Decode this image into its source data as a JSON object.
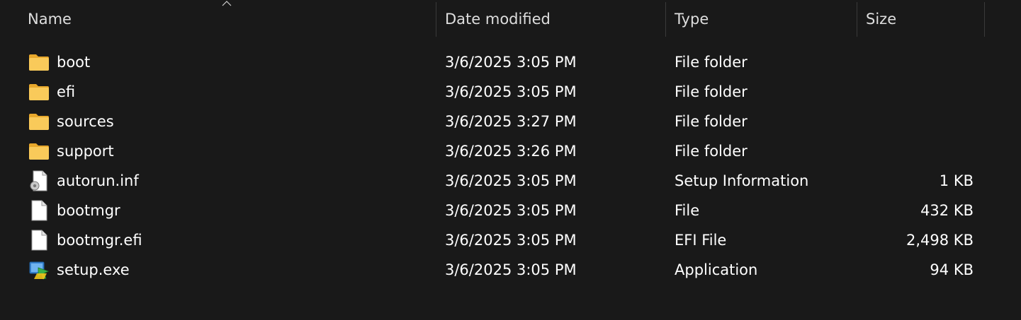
{
  "columns": {
    "name": "Name",
    "date": "Date modified",
    "type": "Type",
    "size": "Size"
  },
  "files": [
    {
      "name": "boot",
      "date": "3/6/2025 3:05 PM",
      "type": "File folder",
      "size": "",
      "icon": "folder-icon"
    },
    {
      "name": "efi",
      "date": "3/6/2025 3:05 PM",
      "type": "File folder",
      "size": "",
      "icon": "folder-icon"
    },
    {
      "name": "sources",
      "date": "3/6/2025 3:27 PM",
      "type": "File folder",
      "size": "",
      "icon": "folder-icon"
    },
    {
      "name": "support",
      "date": "3/6/2025 3:26 PM",
      "type": "File folder",
      "size": "",
      "icon": "folder-icon"
    },
    {
      "name": "autorun.inf",
      "date": "3/6/2025 3:05 PM",
      "type": "Setup Information",
      "size": "1 KB",
      "icon": "setup-info-file-icon"
    },
    {
      "name": "bootmgr",
      "date": "3/6/2025 3:05 PM",
      "type": "File",
      "size": "432 KB",
      "icon": "file-icon"
    },
    {
      "name": "bootmgr.efi",
      "date": "3/6/2025 3:05 PM",
      "type": "EFI File",
      "size": "2,498 KB",
      "icon": "file-icon"
    },
    {
      "name": "setup.exe",
      "date": "3/6/2025 3:05 PM",
      "type": "Application",
      "size": "94 KB",
      "icon": "setup-exe-icon"
    }
  ],
  "colors": {
    "background": "#191919",
    "header_text": "#dedede",
    "text": "#ffffff",
    "divider": "#3a3a3a",
    "folder": "#f4c145"
  }
}
